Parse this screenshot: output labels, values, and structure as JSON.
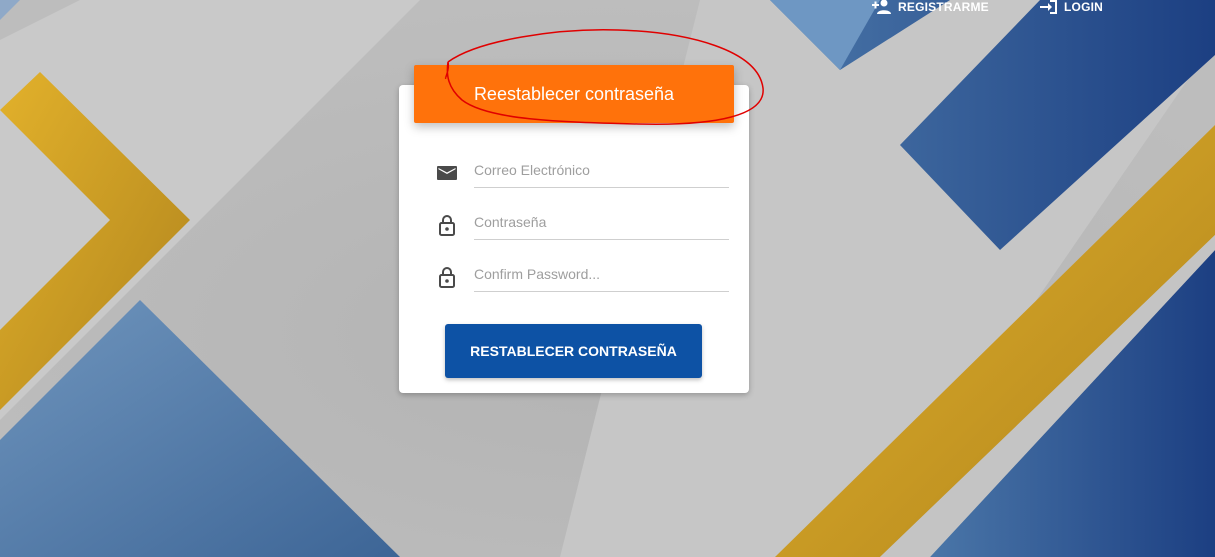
{
  "nav": {
    "register_label": "REGISTRARME",
    "register_icon": "person-add-icon",
    "login_label": "LOGIN",
    "login_icon": "login-arrow-icon"
  },
  "card": {
    "title": "Reestablecer contraseña",
    "fields": [
      {
        "icon": "mail-icon",
        "placeholder": "Correo Electrónico",
        "value": ""
      },
      {
        "icon": "lock-icon",
        "placeholder": "Contraseña",
        "value": ""
      },
      {
        "icon": "lock-icon",
        "placeholder": "Confirm Password...",
        "value": ""
      }
    ],
    "submit_label": "RESTABLECER CONTRASEÑA"
  },
  "colors": {
    "header_accent": "#ff720b",
    "button": "#0d52a5",
    "annotation": "#e00000"
  }
}
